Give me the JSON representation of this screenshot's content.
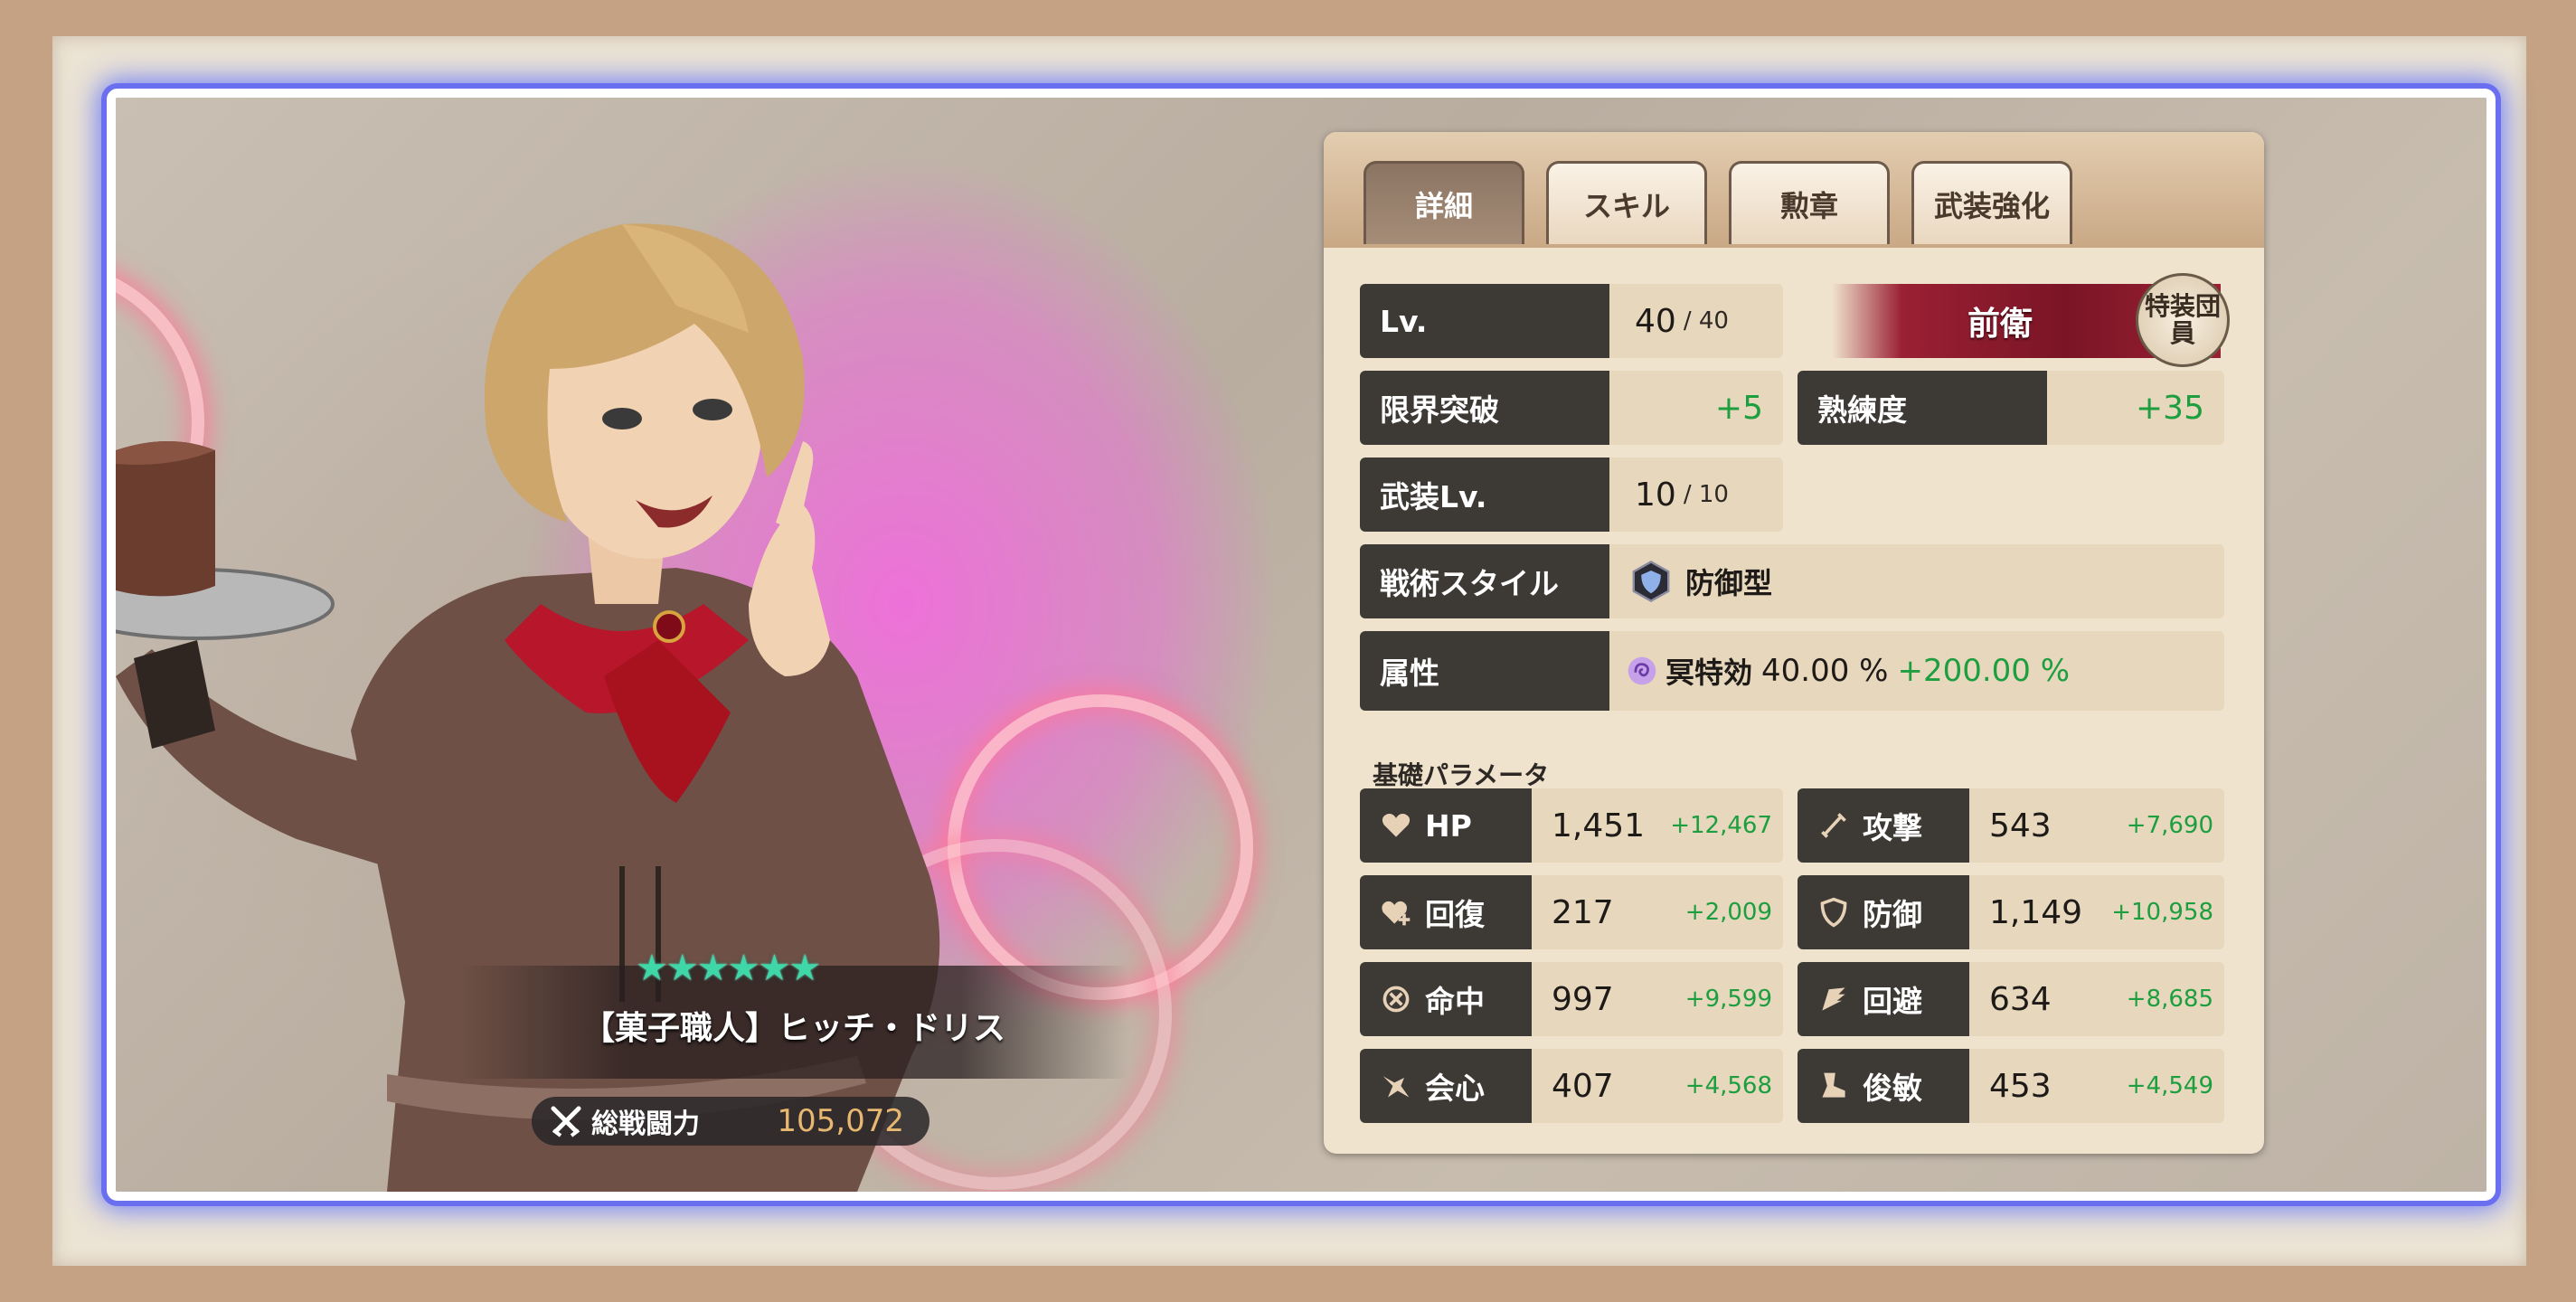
{
  "tabs": [
    "詳細",
    "スキル",
    "勲章",
    "武装強化"
  ],
  "character": {
    "name": "【菓子職人】ヒッチ・ドリス",
    "stars": "★★★★★★",
    "power_label": "総戦闘力",
    "power_value": "105,072"
  },
  "details": {
    "level_label": "Lv.",
    "level_value": "40",
    "level_max": "/ 40",
    "position": "前衛",
    "badge": "特装団員",
    "limit_break_label": "限界突破",
    "limit_break_value": "+5",
    "proficiency_label": "熟練度",
    "proficiency_value": "+35",
    "arms_level_label": "武装Lv.",
    "arms_level_value": "10",
    "arms_level_max": "/ 10",
    "style_label": "戦術スタイル",
    "style_value": "防御型",
    "attribute_label": "属性",
    "attribute_name": "冥特効",
    "attribute_value": "40.00 %",
    "attribute_bonus": "+200.00 %"
  },
  "params_title": "基礎パラメータ",
  "params": [
    {
      "label": "HP",
      "icon": "heart-icon",
      "value": "1,451",
      "bonus": "+12,467"
    },
    {
      "label": "攻撃",
      "icon": "sword-icon",
      "value": "543",
      "bonus": "+7,690"
    },
    {
      "label": "回復",
      "icon": "heart-plus-icon",
      "value": "217",
      "bonus": "+2,009"
    },
    {
      "label": "防御",
      "icon": "shield-icon",
      "value": "1,149",
      "bonus": "+10,958"
    },
    {
      "label": "命中",
      "icon": "crosshair-icon",
      "value": "997",
      "bonus": "+9,599"
    },
    {
      "label": "回避",
      "icon": "wing-icon",
      "value": "634",
      "bonus": "+8,685"
    },
    {
      "label": "会心",
      "icon": "critical-icon",
      "value": "407",
      "bonus": "+4,568"
    },
    {
      "label": "俊敏",
      "icon": "boot-icon",
      "value": "453",
      "bonus": "+4,549"
    }
  ],
  "colors": {
    "accent_blue": "#6a6ff0",
    "bonus_green": "#1d9e3f",
    "label_dark": "#3d3935",
    "vanguard_red": "#9a2033"
  }
}
